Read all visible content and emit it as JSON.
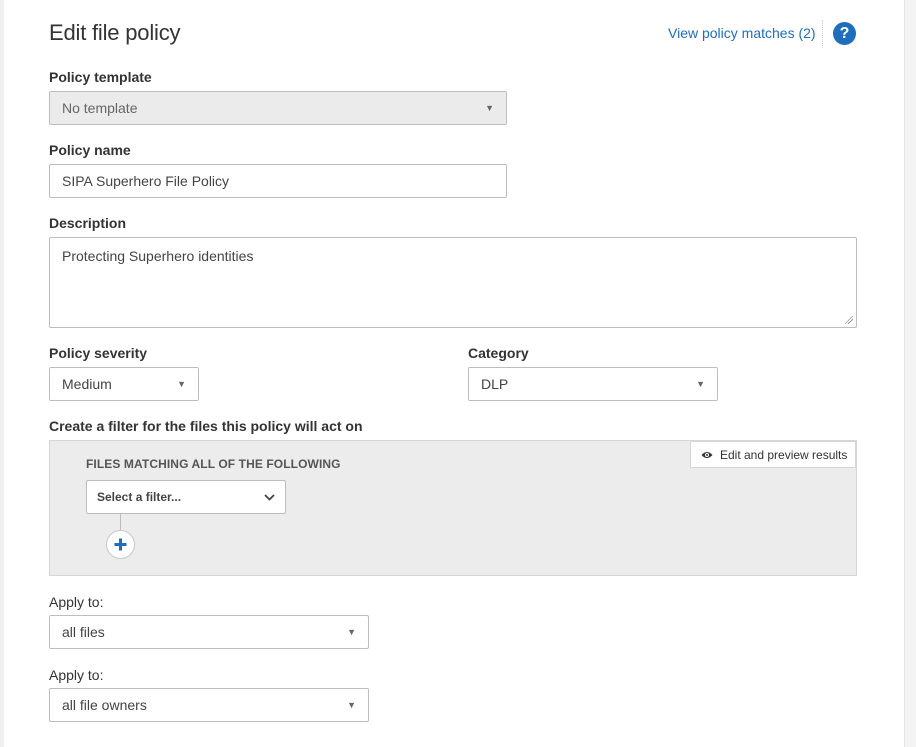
{
  "header": {
    "title": "Edit file policy",
    "matches_link": "View policy matches (2)",
    "help_glyph": "?"
  },
  "form": {
    "template": {
      "label": "Policy template",
      "value": "No template"
    },
    "name": {
      "label": "Policy name",
      "value": "SIPA Superhero File Policy"
    },
    "description": {
      "label": "Description",
      "value": "Protecting Superhero identities"
    },
    "severity": {
      "label": "Policy severity",
      "value": "Medium"
    },
    "category": {
      "label": "Category",
      "value": "DLP"
    },
    "filter": {
      "label": "Create a filter for the files this policy will act on",
      "preview_button": "Edit and preview results",
      "heading": "FILES MATCHING ALL OF THE FOLLOWING",
      "select_placeholder": "Select a filter..."
    },
    "apply_files": {
      "label": "Apply to:",
      "value": "all files"
    },
    "apply_owners": {
      "label": "Apply to:",
      "value": "all file owners"
    }
  },
  "colors": {
    "link": "#1e6ebd",
    "panel": "#ececec",
    "disabled_field": "#ebebeb"
  },
  "icons": {
    "help": "question-circle-icon",
    "preview": "eye-icon",
    "dropdown": "caret-down-icon",
    "chevron": "chevron-down-icon",
    "add": "plus-icon"
  }
}
